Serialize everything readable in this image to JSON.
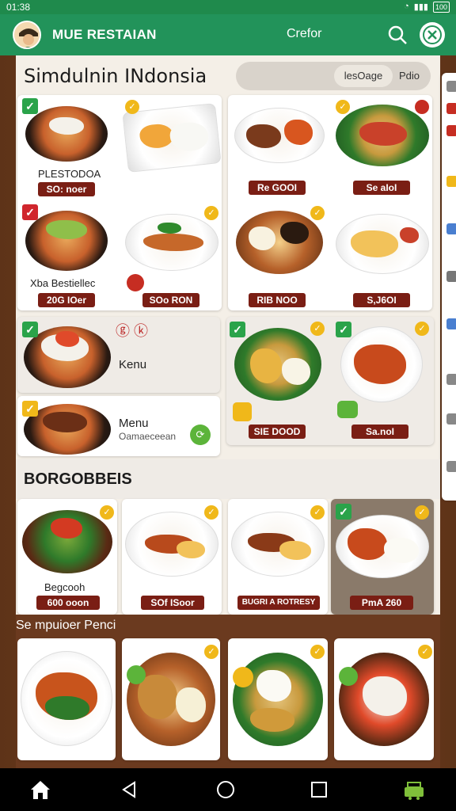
{
  "status": {
    "time": "01:38",
    "signal": "▮▮▮",
    "wifi": "◔",
    "battery": "100"
  },
  "app": {
    "title": "MUE RESTAIAN",
    "action": "Crefor"
  },
  "header": {
    "title": "Simdulnin INdonsia",
    "seg": [
      "lesOage",
      "Pdio"
    ]
  },
  "grid1": {
    "cards": [
      {
        "label": "PLESTODOA",
        "price": "SO: noer"
      },
      {
        "price": "Re GOOI"
      },
      {
        "price": "Se aIoI"
      },
      {
        "label": "Xba Bestiellec",
        "price": "20G IOer"
      },
      {
        "price": "SOo RON"
      },
      {
        "price": "RIB NOO"
      },
      {
        "price": "S,J6OI"
      }
    ]
  },
  "grid2": {
    "glyph": "ⓖ ⓚ",
    "menu1": "Kenu",
    "menu2": "Menu",
    "menu2_sub": "Oamaeceean",
    "prices": [
      "SIE DOOD",
      "Sa.noI"
    ]
  },
  "section": {
    "title": "BORGOBBEIS"
  },
  "grid3": [
    {
      "label": "Begcooh",
      "price": "600 ooon"
    },
    {
      "price": "SOf ISoor"
    },
    {
      "price": "BUGRI A ROTRESY"
    },
    {
      "price": "PmA 260"
    }
  ],
  "sub_section": {
    "title": "Se mpuioer Penci"
  },
  "colors": {
    "accent": "#22935a",
    "price": "#7a1e14",
    "background": "#6b3a1f"
  }
}
